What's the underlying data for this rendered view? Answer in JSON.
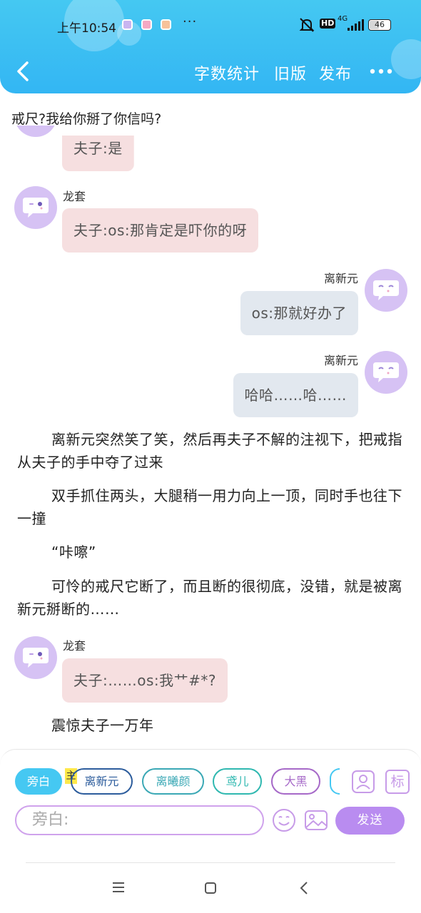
{
  "status": {
    "time": "上午10:54",
    "dots": "···",
    "hd": "HD",
    "network": "4G",
    "battery": "46",
    "battery_level": 0.46
  },
  "nav": {
    "word_count": "字数统计",
    "old_version": "旧版",
    "publish": "发布"
  },
  "story": {
    "top_line": "戒尺?我给你掰了你信吗?",
    "messages": [
      {
        "speaker": "",
        "text": "夫子:是",
        "side": "left"
      },
      {
        "speaker": "龙套",
        "text": "夫子:os:那肯定是吓你的呀",
        "side": "left"
      },
      {
        "speaker": "离新元",
        "text": "os:那就好办了",
        "side": "right"
      },
      {
        "speaker": "离新元",
        "text": "哈哈……哈……",
        "side": "right"
      }
    ],
    "paragraphs": [
      "离新元突然笑了笑，然后再夫子不解的注视下，把戒指从夫子的手中夺了过来",
      "双手抓住两头，大腿稍一用力向上一顶，同时手也往下一撞",
      "“咔嚓”",
      "可怜的戒尺它断了，而且断的很彻底，没错，就是被离新元掰断的……"
    ],
    "last_message": {
      "speaker": "龙套",
      "text": "夫子:……os:我艹#*?"
    },
    "last_paragraph": "震惊夫子一万年"
  },
  "composer": {
    "roles": [
      {
        "label": "旁白",
        "color": "#45c8f2",
        "active": true
      },
      {
        "label": "离新元",
        "color": "#2c5c9c",
        "active": false
      },
      {
        "label": "离曦颜",
        "color": "#3aa8b5",
        "active": false
      },
      {
        "label": "鸢儿",
        "color": "#2fb8b0",
        "active": false
      },
      {
        "label": "大黑",
        "color": "#a669c8",
        "active": false
      }
    ],
    "main_tag": "主",
    "mark_label": "标",
    "input_placeholder": "旁白:",
    "send_label": "发送"
  },
  "colors": {
    "header": "#39bcf3",
    "accent_purple": "#b98cf0",
    "left_bubble": "#f6dfe0",
    "right_bubble": "#e2e8ef"
  }
}
